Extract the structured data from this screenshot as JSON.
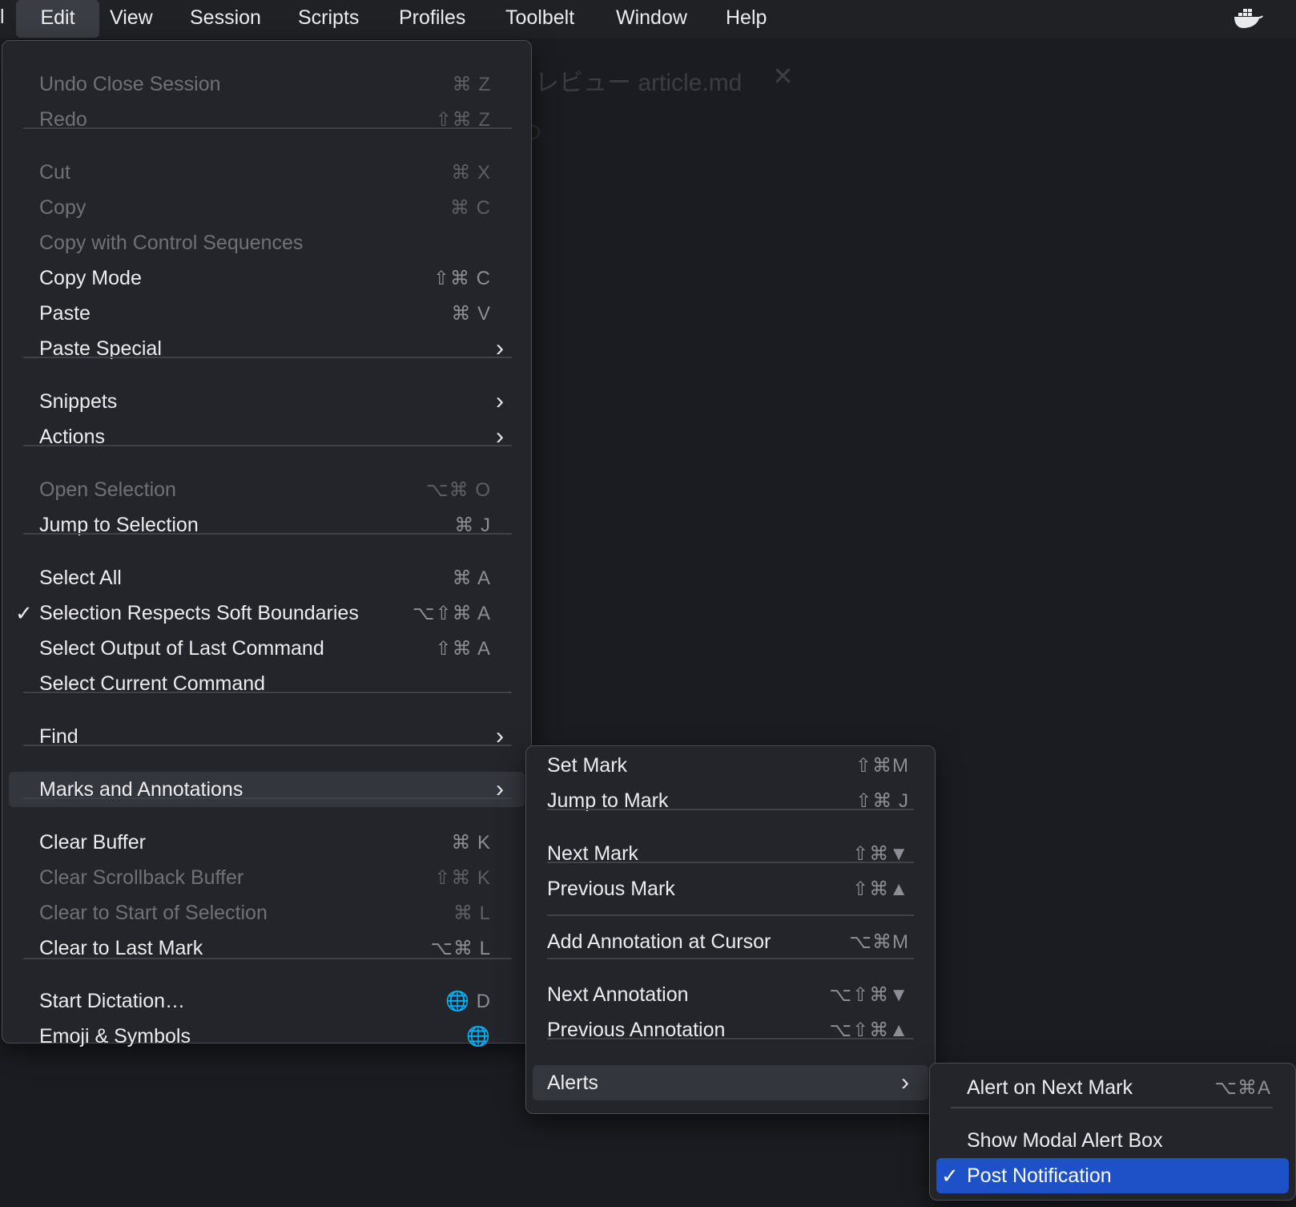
{
  "menubar": {
    "app_fragment": "l",
    "items": [
      "Edit",
      "View",
      "Session",
      "Scripts",
      "Profiles",
      "Toolbelt",
      "Window",
      "Help"
    ]
  },
  "background": {
    "tab_title": "レビュー article.md",
    "close_glyph": "✕"
  },
  "edit_menu": [
    {
      "label": "Undo Close Session",
      "shortcut": "⌘ Z",
      "disabled": true
    },
    {
      "label": "Redo",
      "shortcut": "⇧⌘ Z",
      "disabled": true
    },
    {
      "label": "Cut",
      "shortcut": "⌘ X",
      "disabled": true
    },
    {
      "label": "Copy",
      "shortcut": "⌘ C",
      "disabled": true
    },
    {
      "label": "Copy with Control Sequences",
      "shortcut": "",
      "disabled": true
    },
    {
      "label": "Copy Mode",
      "shortcut": "⇧⌘ C"
    },
    {
      "label": "Paste",
      "shortcut": "⌘ V"
    },
    {
      "label": "Paste Special",
      "submenu": true
    },
    {
      "label": "Snippets",
      "submenu": true
    },
    {
      "label": "Actions",
      "submenu": true
    },
    {
      "label": "Open Selection",
      "shortcut": "⌥⌘ O",
      "disabled": true
    },
    {
      "label": "Jump to Selection",
      "shortcut": "⌘ J"
    },
    {
      "label": "Select All",
      "shortcut": "⌘ A"
    },
    {
      "label": "Selection Respects Soft Boundaries",
      "shortcut": "⌥⇧⌘ A",
      "checked": true
    },
    {
      "label": "Select Output of Last Command",
      "shortcut": "⇧⌘ A"
    },
    {
      "label": "Select Current Command",
      "shortcut": ""
    },
    {
      "label": "Find",
      "submenu": true
    },
    {
      "label": "Marks and Annotations",
      "submenu": true,
      "highlighted": true
    },
    {
      "label": "Clear Buffer",
      "shortcut": "⌘ K"
    },
    {
      "label": "Clear Scrollback Buffer",
      "shortcut": "⇧⌘ K",
      "disabled": true
    },
    {
      "label": "Clear to Start of Selection",
      "shortcut": "⌘ L",
      "disabled": true
    },
    {
      "label": "Clear to Last Mark",
      "shortcut": "⌥⌘ L"
    },
    {
      "label": "Start Dictation…",
      "shortcut": "🌐 D"
    },
    {
      "label": "Emoji & Symbols",
      "shortcut": "🌐"
    }
  ],
  "marks_menu": [
    {
      "label": "Set Mark",
      "shortcut": "⇧⌘M"
    },
    {
      "label": "Jump to Mark",
      "shortcut": "⇧⌘ J"
    },
    {
      "label": "Next Mark",
      "shortcut": "⇧⌘▼"
    },
    {
      "label": "Previous Mark",
      "shortcut": "⇧⌘▲"
    },
    {
      "label": "Add Annotation at Cursor",
      "shortcut": "⌥⌘M"
    },
    {
      "label": "Next Annotation",
      "shortcut": "⌥⇧⌘▼"
    },
    {
      "label": "Previous Annotation",
      "shortcut": "⌥⇧⌘▲"
    },
    {
      "label": "Alerts",
      "submenu": true,
      "highlighted": true
    }
  ],
  "alerts_menu": [
    {
      "label": "Alert on Next Mark",
      "shortcut": "⌥⌘A"
    },
    {
      "label": "Show Modal Alert Box",
      "shortcut": ""
    },
    {
      "label": "Post Notification",
      "shortcut": "",
      "checked": true,
      "selected": true
    }
  ],
  "glyphs": {
    "chevron": "›",
    "check": "✓"
  },
  "colors": {
    "selection": "#1e50c8",
    "highlight": "#34363d",
    "menu_bg": "#24252b"
  }
}
